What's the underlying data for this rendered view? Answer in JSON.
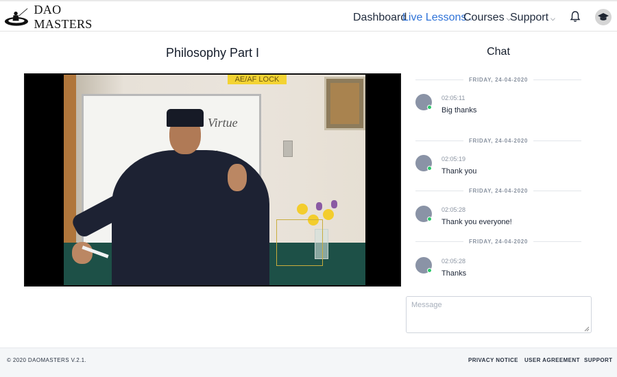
{
  "brand": {
    "name": "DAO MASTERS"
  },
  "nav": {
    "dashboard": "Dashboard",
    "live_lessons": "Live Lessons",
    "courses": "Courses",
    "support": "Support"
  },
  "icons": {
    "bell": "bell-icon",
    "user": "graduation-cap-icon",
    "chevron": "chevron-down-icon"
  },
  "colors": {
    "accent": "#2f73d8",
    "online": "#2ac76a",
    "video_table": "#1d5047"
  },
  "video": {
    "title": "Philosophy Part I",
    "overlay_label": "AE/AF LOCK",
    "board_word": "Virtue"
  },
  "chat": {
    "title": "Chat",
    "messages": [
      {
        "date": "FRIDAY, 24-04-2020",
        "time": "02:05:11",
        "text": "Big thanks"
      },
      {
        "date": "FRIDAY, 24-04-2020",
        "time": "02:05:19",
        "text": "Thank you"
      },
      {
        "date": "FRIDAY, 24-04-2020",
        "time": "02:05:28",
        "text": "Thank you everyone!"
      },
      {
        "date": "FRIDAY, 24-04-2020",
        "time": "02:05:28",
        "text": "Thanks"
      }
    ],
    "input": {
      "placeholder": "Message",
      "value": ""
    }
  },
  "footer": {
    "copyright": "© 2020 DAOMASTERS V.2.1.",
    "privacy": "PRIVACY NOTICE",
    "agreement": "USER AGREEMENT",
    "support": "SUPPORT"
  }
}
